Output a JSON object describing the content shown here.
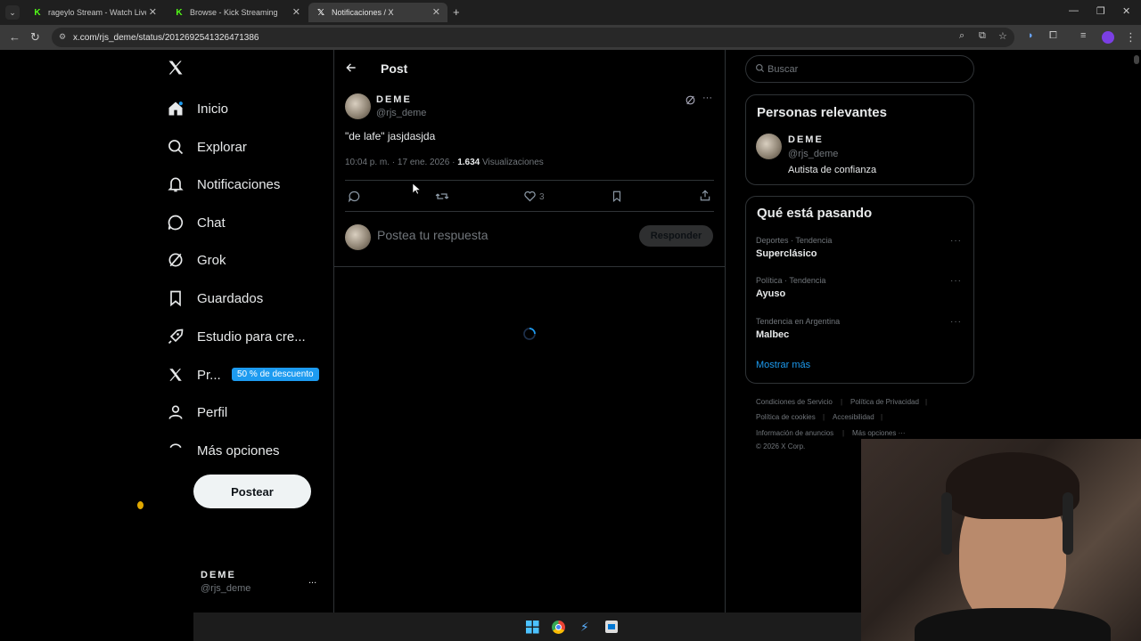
{
  "browser": {
    "tabs": [
      {
        "title": "rageylo Stream - Watch Live on",
        "favicon": "kick-icon"
      },
      {
        "title": "Browse - Kick Streaming",
        "favicon": "kick-icon"
      },
      {
        "title": "Notificaciones / X",
        "favicon": "x-icon"
      }
    ],
    "url": "x.com/rjs_deme/status/2012692541326471386"
  },
  "sidebar": {
    "items": [
      {
        "label": "Inicio",
        "icon": "home-icon"
      },
      {
        "label": "Explorar",
        "icon": "search-icon"
      },
      {
        "label": "Notificaciones",
        "icon": "bell-icon"
      },
      {
        "label": "Chat",
        "icon": "chat-icon"
      },
      {
        "label": "Grok",
        "icon": "grok-icon"
      },
      {
        "label": "Guardados",
        "icon": "bookmark-icon"
      },
      {
        "label": "Estudio para cre...",
        "icon": "rocket-icon"
      },
      {
        "label": "Pr...",
        "icon": "x-icon"
      },
      {
        "label": "Perfil",
        "icon": "person-icon"
      },
      {
        "label": "Más opciones",
        "icon": "more-circle-icon"
      }
    ],
    "promo_badge": "50 % de descuento",
    "post_button": "Postear",
    "account": {
      "name": "DEME",
      "handle": "@rjs_deme",
      "more": "..."
    }
  },
  "main": {
    "header_title": "Post",
    "post": {
      "author_name": "DEME",
      "author_handle": "@rjs_deme",
      "text": "\"de lafe\" jasjdasjda",
      "timestamp": "10:04 p. m. · 17 ene. 2026 ·",
      "views_count": "1.634",
      "views_label": "Visualizaciones",
      "likes": "3"
    },
    "reply_placeholder": "Postea tu respuesta",
    "reply_button": "Responder"
  },
  "right": {
    "search_placeholder": "Buscar",
    "relevant": {
      "title": "Personas relevantes",
      "name": "DEME",
      "handle": "@rjs_deme",
      "bio": "Autista de confianza"
    },
    "trends": {
      "title": "Qué está pasando",
      "items": [
        {
          "category": "Deportes · Tendencia",
          "name": "Superclásico"
        },
        {
          "category": "Política · Tendencia",
          "name": "Ayuso"
        },
        {
          "category": "Tendencia en Argentina",
          "name": "Malbec"
        }
      ],
      "show_more": "Mostrar más"
    },
    "footer": {
      "links": [
        "Condiciones de Servicio",
        "Política de Privacidad",
        "Política de cookies",
        "Accesibilidad",
        "Información de anuncios",
        "Más opciones ···"
      ],
      "copyright": "© 2026 X Corp."
    }
  },
  "colors": {
    "accent": "#1d9bf0",
    "link": "#1d9bf0",
    "background": "#000000",
    "border": "#2f3336",
    "muted": "#71767b"
  }
}
